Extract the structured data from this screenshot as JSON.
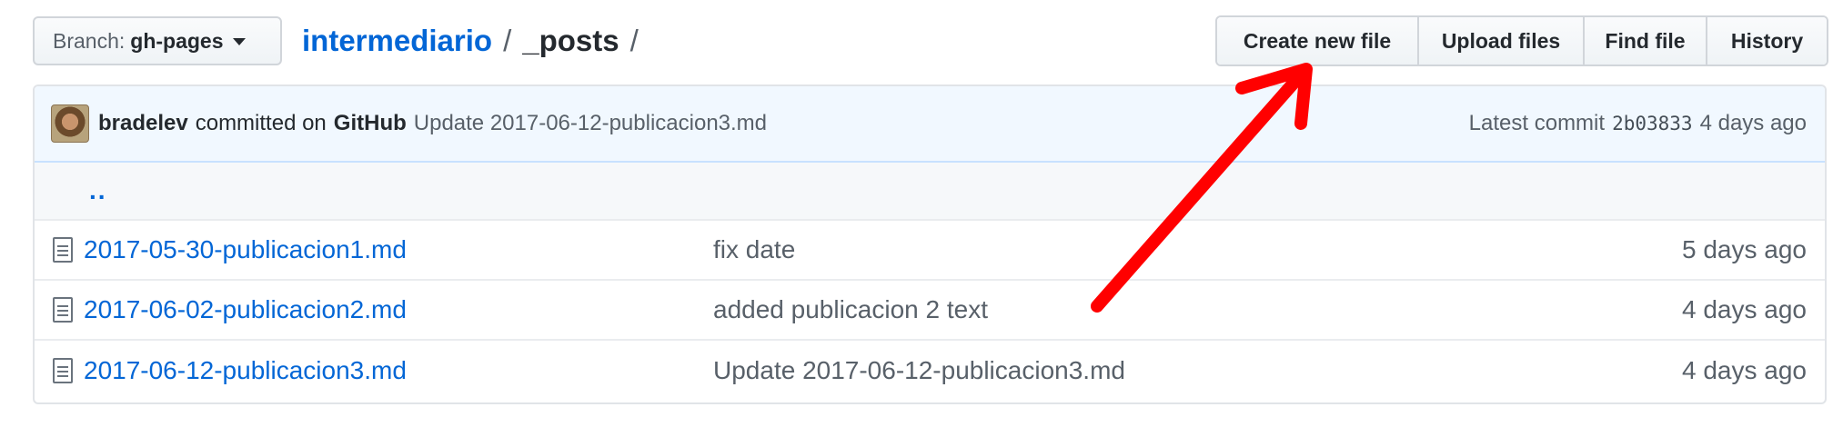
{
  "branch": {
    "label": "Branch:",
    "name": "gh-pages"
  },
  "breadcrumb": {
    "repo": "intermediario",
    "separator": "/",
    "dir": "_posts",
    "trailing": "/"
  },
  "actions": {
    "create_new_file": "Create new file",
    "upload_files": "Upload files",
    "find_file": "Find file",
    "history": "History"
  },
  "latest_commit": {
    "author": "bradelev",
    "verb": "committed on",
    "platform": "GitHub",
    "message": "Update 2017-06-12-publicacion3.md",
    "label": "Latest commit",
    "sha": "2b03833",
    "age": "4 days ago"
  },
  "parent_dir": "..",
  "files": [
    {
      "name": "2017-05-30-publicacion1.md",
      "message": "fix date",
      "age": "5 days ago"
    },
    {
      "name": "2017-06-02-publicacion2.md",
      "message": "added publicacion 2 text",
      "age": "4 days ago"
    },
    {
      "name": "2017-06-12-publicacion3.md",
      "message": "Update 2017-06-12-publicacion3.md",
      "age": "4 days ago"
    }
  ],
  "colors": {
    "link": "#0366d6",
    "commit_tease_bg": "#f1f8ff",
    "annotation_arrow": "#ff0000"
  }
}
